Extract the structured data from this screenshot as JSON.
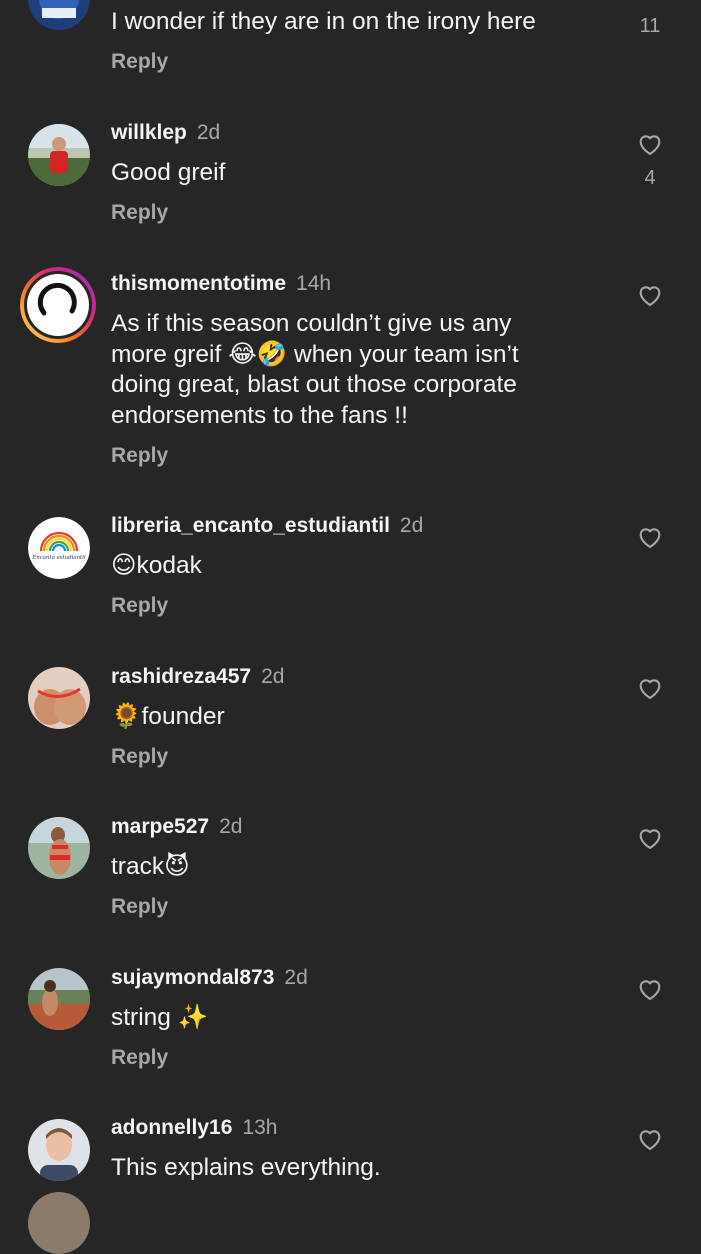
{
  "reply_label": "Reply",
  "comments": [
    {
      "username": "",
      "time": "",
      "text": "I wonder if they are in on the irony here",
      "likes": "11"
    },
    {
      "username": "willklep",
      "time": "2d",
      "text": "Good greif",
      "likes": "4"
    },
    {
      "username": "thismomentotime",
      "time": "14h",
      "text": "As if this season couldn’t give us any more greif 😂🤣 when your team isn’t doing great, blast out those corporate endorsements to the fans !!",
      "likes": ""
    },
    {
      "username": "libreria_encanto_estudiantil",
      "time": "2d",
      "text": "😊kodak",
      "likes": "",
      "avatar_text": "Encanto estudiantil"
    },
    {
      "username": "rashidreza457",
      "time": "2d",
      "text": "🌻founder",
      "likes": ""
    },
    {
      "username": "marpe527",
      "time": "2d",
      "text": "track😈",
      "likes": ""
    },
    {
      "username": "sujaymondal873",
      "time": "2d",
      "text": "string ✨",
      "likes": ""
    },
    {
      "username": "adonnelly16",
      "time": "13h",
      "text": "This explains everything.",
      "likes": ""
    }
  ],
  "icons": {
    "like": "heart-outline-icon"
  },
  "colors": {
    "background": "#262626",
    "primary_text": "#f5f5f5",
    "secondary_text": "#a8a8a8",
    "story_ring": [
      "#feda75",
      "#fa7e1e",
      "#d62976",
      "#962fbf"
    ]
  }
}
